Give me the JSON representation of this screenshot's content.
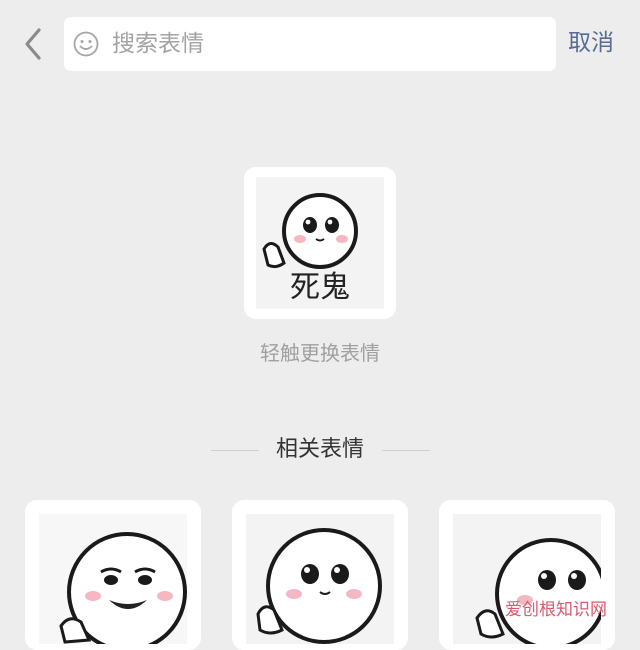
{
  "header": {
    "back_icon": "chevron-left-icon",
    "search": {
      "icon": "smiley-icon",
      "placeholder": "搜索表情"
    },
    "cancel_label": "取消"
  },
  "preview": {
    "sticker_caption": "死鬼",
    "hint": "轻触更换表情"
  },
  "related": {
    "title": "相关表情",
    "items": [
      {
        "id": "sticker-1"
      },
      {
        "id": "sticker-2"
      },
      {
        "id": "sticker-3"
      }
    ]
  },
  "watermark": "爱创根知识网",
  "colors": {
    "background": "#ededed",
    "accent": "#576b95",
    "hint": "#a0a0a0",
    "watermark": "#d9596d"
  }
}
